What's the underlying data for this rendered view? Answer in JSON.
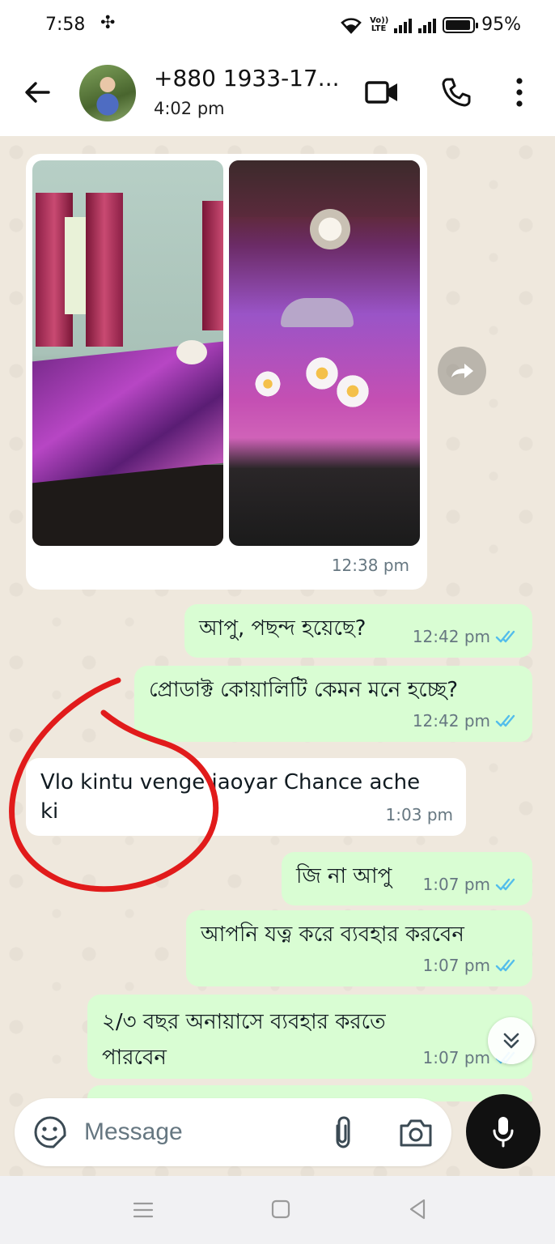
{
  "status_bar": {
    "time": "7:58",
    "volte_label": "Vo)) LTE",
    "battery": "95%",
    "battery_level": 0.95
  },
  "header": {
    "contact_name": "+880 1933-17...",
    "last_seen": "4:02 pm",
    "icons": [
      "back-arrow-icon",
      "video-call-icon",
      "phone-icon",
      "more-vert-icon"
    ]
  },
  "messages": [
    {
      "type": "image",
      "direction": "in",
      "images": 2,
      "time": "12:38 pm"
    },
    {
      "direction": "out",
      "text": "আপু, পছন্দ হয়েছে?",
      "time": "12:42 pm",
      "status": "read"
    },
    {
      "direction": "out",
      "text": "প্রোডাক্ট কোয়ালিটি কেমন মনে হচ্ছে?",
      "time": "12:42 pm",
      "status": "read"
    },
    {
      "direction": "in",
      "text": "Vlo kintu venge jaoyar Chance ache ki",
      "time": "1:03 pm"
    },
    {
      "direction": "out",
      "text": "জি না আপু",
      "time": "1:07 pm",
      "status": "read"
    },
    {
      "direction": "out",
      "text": "আপনি যত্ন করে ব্যবহার করবেন",
      "time": "1:07 pm",
      "status": "read"
    },
    {
      "direction": "out",
      "text": "২/৩ বছর অনায়াসে ব্যবহার করতে পারবেন",
      "time": "1:07 pm",
      "status": "read"
    }
  ],
  "composer": {
    "placeholder": "Message"
  },
  "colors": {
    "outgoing_bubble": "#d9fdd3",
    "incoming_bubble": "#ffffff",
    "chat_background": "#efe8dd",
    "read_tick": "#53bdeb",
    "annotation": "#e11b1b",
    "mic_button": "#111111"
  }
}
